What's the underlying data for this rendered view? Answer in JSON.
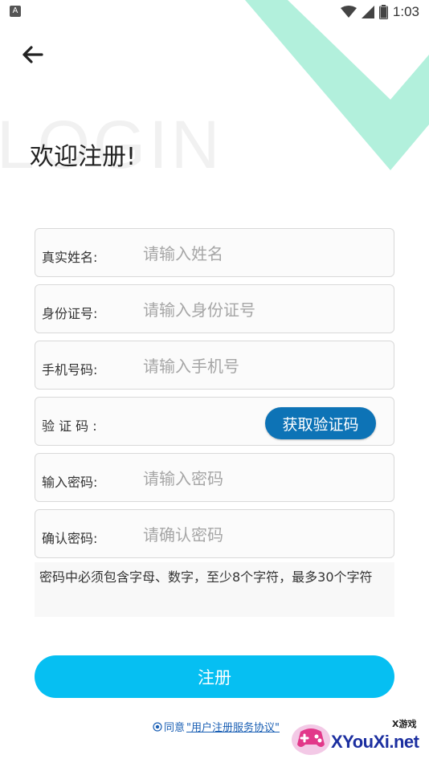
{
  "status_bar": {
    "app_icon": "A",
    "time": "1:03"
  },
  "watermark": "LOGIN",
  "title": "欢迎注册!",
  "fields": [
    {
      "label": "真实姓名:",
      "placeholder": "请输入姓名"
    },
    {
      "label": "身份证号:",
      "placeholder": "请输入身份证号"
    },
    {
      "label": "手机号码:",
      "placeholder": "请输入手机号"
    },
    {
      "label": "验 证 码 :",
      "placeholder": ""
    },
    {
      "label": "输入密码:",
      "placeholder": "请输入密码"
    },
    {
      "label": "确认密码:",
      "placeholder": "请确认密码"
    }
  ],
  "sms_button": "获取验证码",
  "password_hint": "密码中必须包含字母、数字，至少8个字符，最多30个字符",
  "register_button": "注册",
  "agreement": {
    "prefix": "同意",
    "link": "\"用户注册服务协议\""
  },
  "site_logo": {
    "name": "XYouXi.net",
    "tag": "X游戏"
  },
  "colors": {
    "accent": "#06bff2",
    "sms_button": "#0d73b6",
    "decoration": "#b2f0dc"
  },
  "icons": [
    "back-arrow-icon",
    "wifi-icon",
    "signal-icon",
    "battery-icon",
    "radio-icon"
  ]
}
